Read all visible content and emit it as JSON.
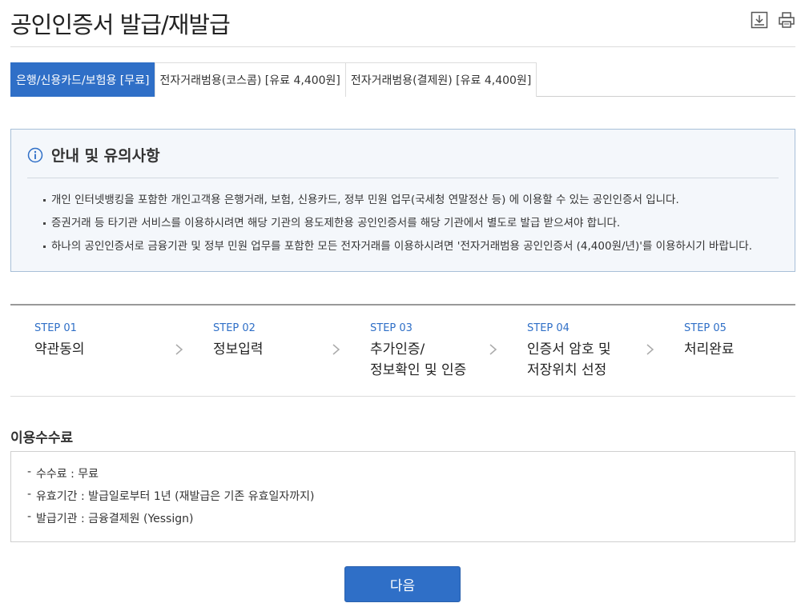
{
  "page": {
    "title": "공인인증서 발급/재발급",
    "icons": [
      "download-icon",
      "print-icon"
    ]
  },
  "tabs": [
    {
      "label": "은행/신용카드/보험용 [무료]",
      "active": true
    },
    {
      "label": "전자거래범용(코스콤) [유료 4,400원]",
      "active": false
    },
    {
      "label": "전자거래범용(결제원) [유료 4,400원]",
      "active": false
    }
  ],
  "notice": {
    "icon": "info-icon",
    "title": "안내 및 유의사항",
    "items": [
      "개인 인터넷뱅킹을 포함한 개인고객용 은행거래, 보험, 신용카드, 정부 민원 업무(국세청 연말정산 등) 에 이용할 수 있는 공인인증서 입니다.",
      "증권거래 등 타기관 서비스를 이용하시려면 해당 기관의 용도제한용 공인인증서를 해당 기관에서 별도로 발급 받으셔야 합니다.",
      "하나의 공인인증서로 금융기관 및 정부 민원 업무를 포함한 모든 전자거래를 이용하시려면 '전자거래범용 공인인증서 (4,400원/년)'를 이용하시기 바랍니다."
    ]
  },
  "steps": [
    {
      "num": "STEP 01",
      "label": "약관동의"
    },
    {
      "num": "STEP 02",
      "label": "정보입력"
    },
    {
      "num": "STEP 03",
      "label": "추가인증/\n정보확인 및 인증"
    },
    {
      "num": "STEP 04",
      "label": "인증서 암호 및\n저장위치 선정"
    },
    {
      "num": "STEP 05",
      "label": "처리완료"
    }
  ],
  "fee": {
    "title": "이용수수료",
    "items": [
      "수수료 : 무료",
      "유효기간 : 발급일로부터 1년 (재발급은 기존 유효일자까지)",
      "발급기관 : 금융결제원 (Yessign)"
    ]
  },
  "next_label": "다음",
  "colors": {
    "accent": "#2f6fc7",
    "notice_bg": "#f4f7fb",
    "notice_border": "#a8bfd8"
  }
}
